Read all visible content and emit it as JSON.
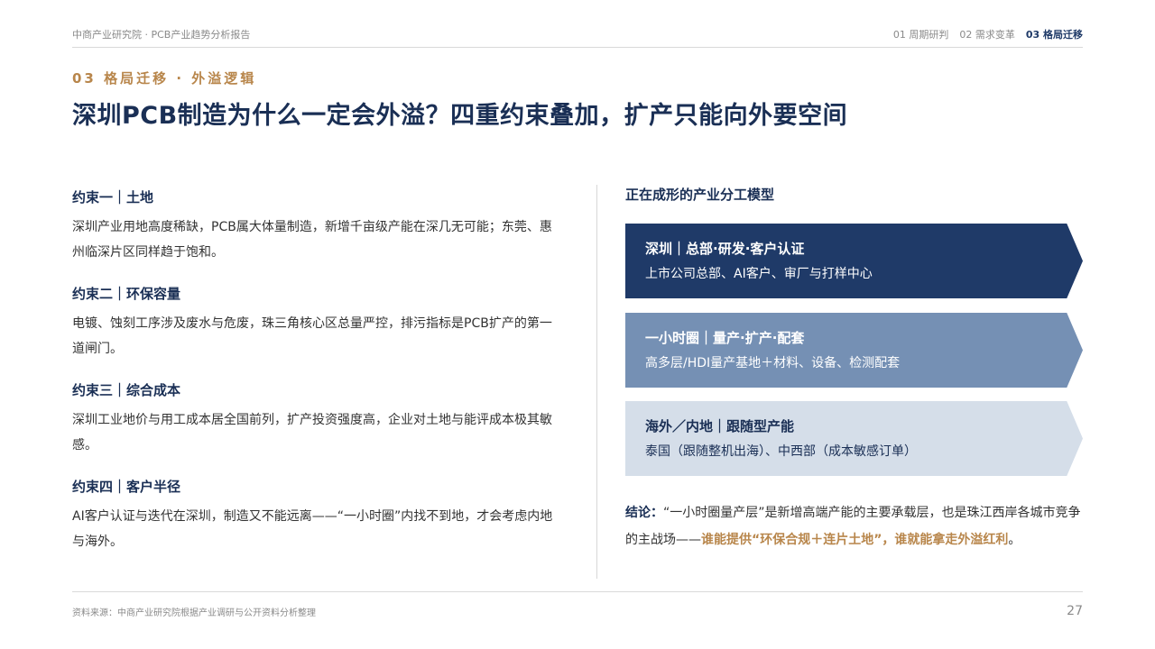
{
  "header": {
    "brand": "中商产业研究院 · PCB产业趋势分析报告",
    "nav": [
      {
        "label": "01 周期研判"
      },
      {
        "label": "02 需求变革"
      },
      {
        "label": "03 格局迁移"
      }
    ],
    "active_index": 2
  },
  "section_label": "03 格局迁移 · 外溢逻辑",
  "title": "深圳PCB制造为什么一定会外溢？四重约束叠加，扩产只能向外要空间",
  "constraints": [
    {
      "title": "约束一｜土地",
      "body": "深圳产业用地高度稀缺，PCB属大体量制造，新增千亩级产能在深几无可能；东莞、惠州临深片区同样趋于饱和。"
    },
    {
      "title": "约束二｜环保容量",
      "body": "电镀、蚀刻工序涉及废水与危废，珠三角核心区总量严控，排污指标是PCB扩产的第一道闸门。"
    },
    {
      "title": "约束三｜综合成本",
      "body": "深圳工业地价与用工成本居全国前列，扩产投资强度高，企业对土地与能评成本极其敏感。"
    },
    {
      "title": "约束四｜客户半径",
      "body": "AI客户认证与迭代在深圳，制造又不能远离——“一小时圈”内找不到地，才会考虑内地与海外。"
    }
  ],
  "model": {
    "title": "正在成形的产业分工模型",
    "tiers": [
      {
        "title": "深圳｜总部·研发·客户认证",
        "desc": "上市公司总部、AI客户、审厂与打样中心",
        "color": "#1f3a68"
      },
      {
        "title": "一小时圈｜量产·扩产·配套",
        "desc": "高多层/HDI量产基地＋材料、设备、检测配套",
        "color": "#7590b4"
      },
      {
        "title": "海外／内地｜跟随型产能",
        "desc": "泰国（跟随整机出海）、中西部（成本敏感订单）",
        "color": "#d5dee9"
      }
    ]
  },
  "conclusion": {
    "label": "结论：",
    "text": "“一小时圈量产层”是新增高端产能的主要承载层，也是珠江西岸各城市竞争的主战场——",
    "highlight": "谁能提供“环保合规＋连片土地”，谁就能拿走外溢红利",
    "end": "。"
  },
  "footer": {
    "source": "资料来源：中商产业研究院根据产业调研与公开资料分析整理",
    "page": "27"
  },
  "colors": {
    "navy": "#1a2f55",
    "gold": "#b8864b"
  }
}
